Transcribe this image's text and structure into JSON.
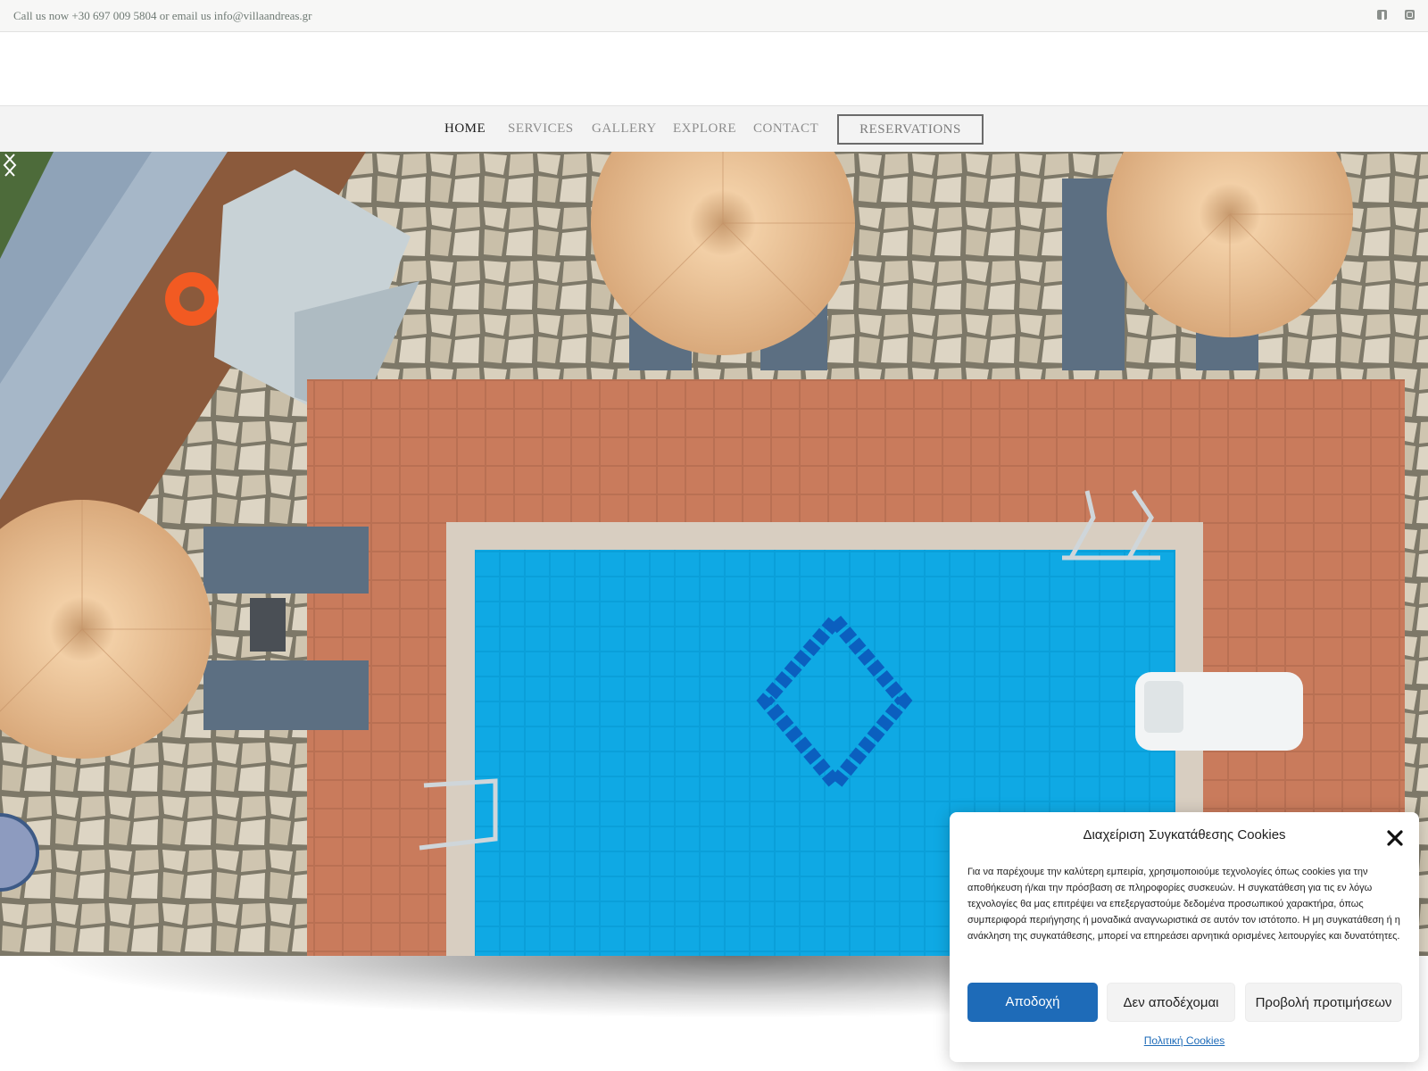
{
  "topbar": {
    "contact_text": "Call us now +30 697 009 5804 or email us info@villaandreas.gr",
    "social_icons": [
      "facebook-icon",
      "instagram-icon"
    ]
  },
  "nav": {
    "items": [
      {
        "label": "HOME",
        "active": true
      },
      {
        "label": "SERVICES",
        "active": false
      },
      {
        "label": "GALLERY",
        "active": false
      },
      {
        "label": "EXPLORE",
        "active": false
      },
      {
        "label": "CONTACT",
        "active": false
      }
    ],
    "reservations_label": "RESERVATIONS"
  },
  "hero": {
    "icons": [
      "chevron-left-icon",
      "chevron-right-icon"
    ]
  },
  "cookie": {
    "title": "Διαχείριση Συγκατάθεσης Cookies",
    "body": "Για να παρέχουμε την καλύτερη εμπειρία, χρησιμοποιούμε τεχνολογίες όπως cookies για την αποθήκευση ή/και την πρόσβαση σε πληροφορίες συσκευών. Η συγκατάθεση για τις εν λόγω τεχνολογίες θα μας επιτρέψει να επεξεργαστούμε δεδομένα προσωπικού χαρακτήρα, όπως συμπεριφορά περιήγησης ή μοναδικά αναγνωριστικά σε αυτόν τον ιστότοπο. Η μη συγκατάθεση ή η ανάκληση της συγκατάθεσης, μπορεί να επηρεάσει αρνητικά ορισμένες λειτουργίες και δυνατότητες.",
    "accept_label": "Αποδοχή",
    "deny_label": "Δεν αποδέχομαι",
    "prefs_label": "Προβολή προτιμήσεων",
    "policy_link": "Πολιτική Cookies"
  },
  "colors": {
    "accent": "#1e6bb8",
    "pool_blue": "#0aa6e0",
    "terracotta": "#c8795b",
    "thatch": "#e9c49a"
  }
}
